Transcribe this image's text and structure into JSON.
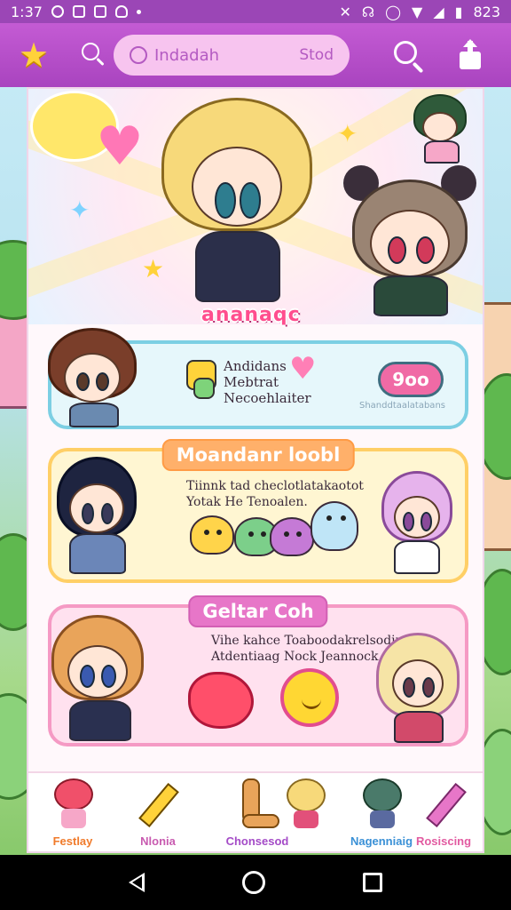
{
  "status_bar": {
    "time": "1:37",
    "battery": "823"
  },
  "app_bar": {
    "search_label": "Indadah",
    "search_trailing": "Stod"
  },
  "hero": {
    "sticker_text": "ananaqc"
  },
  "card_1": {
    "text_line_1": "Andidans",
    "text_line_2": "Mebtrat",
    "text_line_3": "Necoehlaiter",
    "button_label": "9oo",
    "button_caption": "Shanddtaalatabans"
  },
  "card_2": {
    "title": "Moandanr loobl",
    "text_line_1": "Tiinnk tad checlotlatakaotot",
    "text_line_2": "Yotak He Tenoalen."
  },
  "card_3": {
    "title": "Geltar Coh",
    "text_line_1": "Vihe kahce Toaboodakrelsodin",
    "text_line_2": "Atdentiaag Nock Jeannock"
  },
  "bottom_nav": [
    {
      "label": "Festlay",
      "color": "#f07a2a"
    },
    {
      "label": "Nlonia",
      "color": "#c85bb0"
    },
    {
      "label": "Chonsesod",
      "color": "#a44bc7"
    },
    {
      "label": "Nagenniaig",
      "color": "#3a90d6"
    },
    {
      "label": "Rosiscing",
      "color": "#e25ba1"
    }
  ],
  "colors": {
    "app_bar": "#b54fca",
    "status_bar": "#9b46b6",
    "accent_pink": "#f06aa5"
  }
}
